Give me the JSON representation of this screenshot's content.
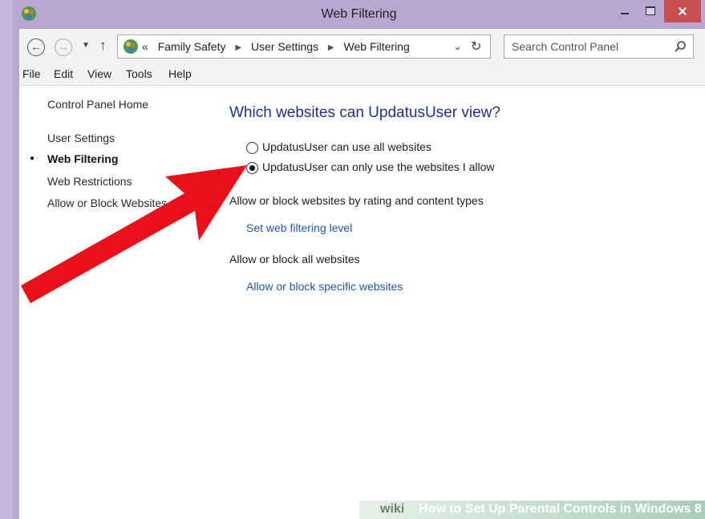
{
  "window": {
    "title": "Web Filtering"
  },
  "navigation": {
    "breadcrumb_lead": "«",
    "breadcrumbs": [
      "Family Safety",
      "User Settings",
      "Web Filtering"
    ],
    "search_placeholder": "Search Control Panel"
  },
  "menu": [
    "File",
    "Edit",
    "View",
    "Tools",
    "Help"
  ],
  "sidebar": {
    "items": [
      {
        "label": "Control Panel Home"
      },
      {
        "label": "User Settings"
      },
      {
        "label": "Web Filtering",
        "current": true
      },
      {
        "label": "Web Restrictions"
      },
      {
        "label": "Allow or Block Websites"
      }
    ]
  },
  "main": {
    "heading": "Which websites can UpdatusUser view?",
    "options": [
      {
        "label": "UpdatusUser can use all websites",
        "selected": false
      },
      {
        "label": "UpdatusUser can only use the websites I allow",
        "selected": true
      }
    ],
    "sections": [
      {
        "title": "Allow or block websites by rating and content types",
        "link": "Set web filtering level"
      },
      {
        "title": "Allow or block all websites",
        "link": "Allow or block specific websites"
      }
    ]
  },
  "watermark": {
    "logo": "wiki",
    "title": "How to Set Up Parental Controls in Windows 8"
  },
  "colors": {
    "heading": "#1e3287",
    "link": "#2456a6",
    "annotation_arrow": "#e8111a",
    "frame": "#b9a6d3",
    "close_button": "#c85050"
  },
  "icons": {
    "window": "family-safety-icon",
    "address": "family-safety-icon",
    "search": "magnifier-icon",
    "back": "back-arrow-icon",
    "forward": "forward-arrow-icon",
    "up": "up-arrow-icon",
    "refresh": "refresh-icon"
  }
}
